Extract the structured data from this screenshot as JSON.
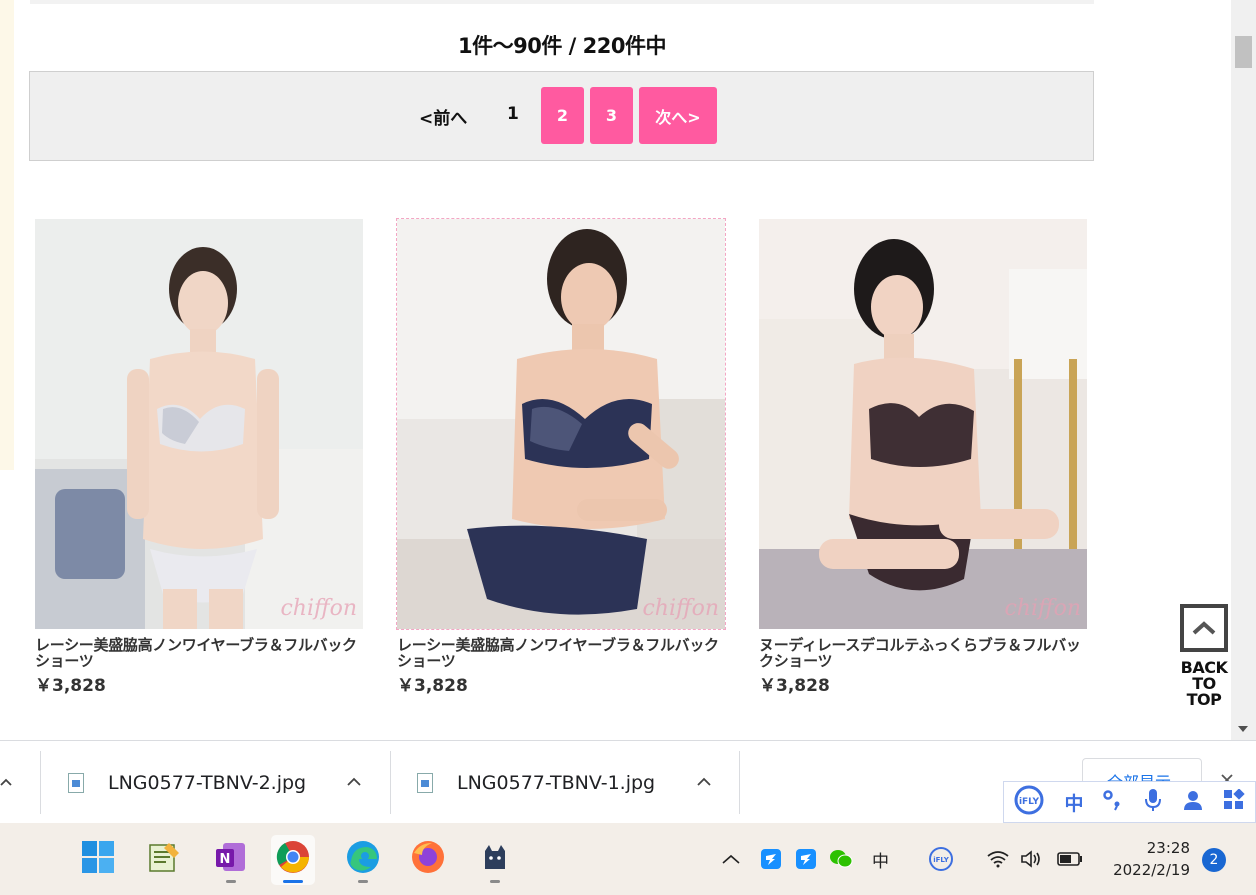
{
  "listing": {
    "count_text": "1件～90件 / 220件中"
  },
  "pagination": {
    "prev": "<前へ",
    "current": "1",
    "page2": "2",
    "page3": "3",
    "next": "次へ>"
  },
  "products": [
    {
      "name": "レーシー美盛脇高ノンワイヤーブラ＆フルバックショーツ",
      "price": "￥3,828",
      "watermark": "chiffon"
    },
    {
      "name": "レーシー美盛脇高ノンワイヤーブラ＆フルバックショーツ",
      "price": "￥3,828",
      "watermark": "chiffon"
    },
    {
      "name": "ヌーディレースデコルテふっくらブラ＆フルバックショーツ",
      "price": "￥3,828",
      "watermark": "chiffon"
    }
  ],
  "back_to_top": {
    "line1": "BACK",
    "line2": "TO",
    "line3": "TOP"
  },
  "downloads": {
    "items": [
      {
        "filename": "LNG0577-TBNV-2.jpg"
      },
      {
        "filename": "LNG0577-TBNV-1.jpg"
      }
    ],
    "show_all": "全部显示"
  },
  "ime_toolbar": {
    "mode": "中"
  },
  "taskbar": {
    "apps": [
      "windows-start",
      "notepad",
      "onenote",
      "chrome",
      "edge",
      "firefox",
      "cat-app"
    ],
    "tray_ime_char": "中",
    "time": "23:28",
    "date": "2022/2/19",
    "notification_count": "2"
  },
  "colors": {
    "pager_button": "#ff5aa0",
    "accent_blue": "#1a73e8",
    "taskbar_bg": "#f3eee8"
  }
}
